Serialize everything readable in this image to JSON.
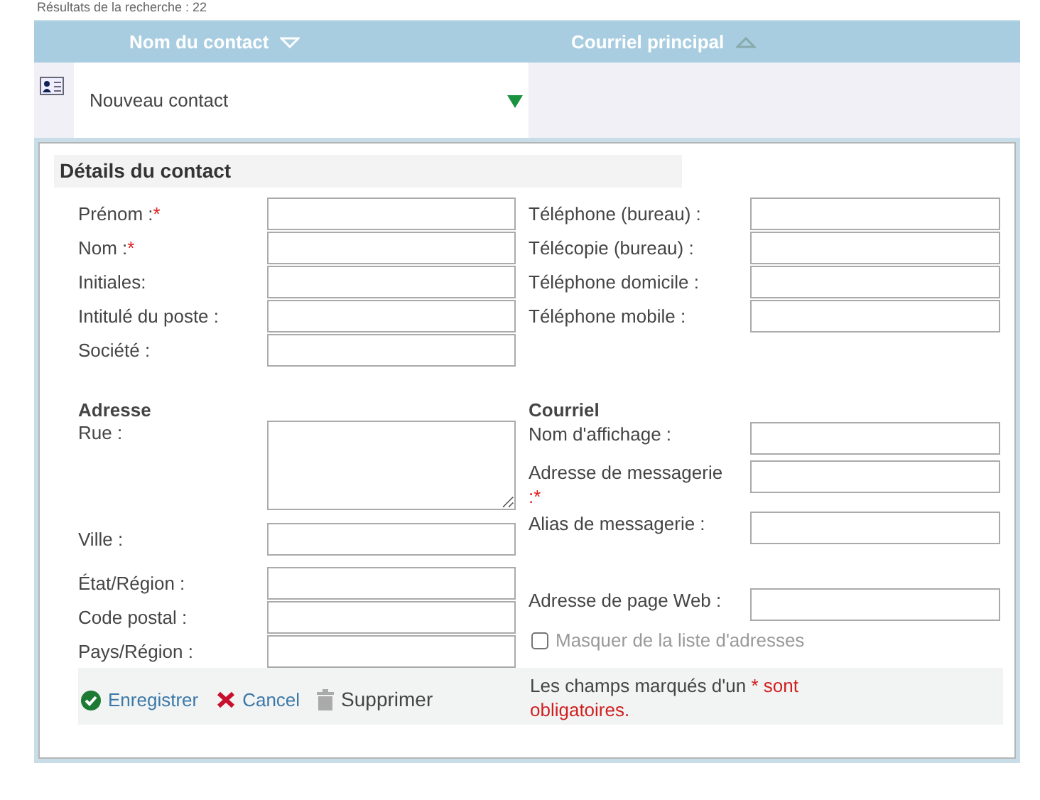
{
  "results_caption": "Résultats de la recherche : 22",
  "table": {
    "columns": [
      {
        "label": "Nom du contact",
        "sort_descending": true
      },
      {
        "label": "Courriel principal",
        "sort_descending": false
      }
    ],
    "rows": [
      {
        "name": "Nouveau contact",
        "expanded": true
      }
    ]
  },
  "details": {
    "title": "Détails du contact",
    "left": [
      {
        "label": "Prénom :",
        "required_mark": "*"
      },
      {
        "label": "Nom :",
        "required_mark": "*"
      },
      {
        "label": "Initiales:"
      },
      {
        "label": "Intitulé du poste :"
      },
      {
        "label": "Société :"
      }
    ],
    "right": [
      {
        "label": "Téléphone (bureau) :"
      },
      {
        "label": "Télécopie (bureau) :"
      },
      {
        "label": "Téléphone domicile :"
      },
      {
        "label": "Téléphone mobile :"
      }
    ]
  },
  "address": {
    "title": "Adresse",
    "fields": [
      {
        "label": "Rue :",
        "kind": "textarea"
      },
      {
        "label": "Ville :",
        "kind": "input"
      },
      {
        "label": "État/Région :",
        "kind": "input"
      },
      {
        "label": "Code postal :",
        "kind": "input"
      },
      {
        "label": "Pays/Région :",
        "kind": "input"
      }
    ]
  },
  "email": {
    "title": "Courriel",
    "fields": [
      {
        "label": "Nom d'affichage :",
        "kind": "input"
      },
      {
        "label": "Adresse de messagerie",
        "required_mark": ":*",
        "kind": "input"
      },
      {
        "label": "Alias de messagerie :",
        "kind": "input"
      },
      {
        "label": "Adresse de page Web :",
        "kind": "input"
      },
      {
        "label": "Masquer de la liste d'adresses",
        "kind": "checkbox",
        "checked": false
      }
    ]
  },
  "actions": [
    {
      "label": "Enregistrer",
      "kind": "save",
      "disabled": false
    },
    {
      "label": "Cancel",
      "kind": "cancel",
      "disabled": false
    },
    {
      "label": "Supprimer",
      "kind": "delete",
      "disabled": true
    }
  ],
  "note": {
    "text": "Les champs marqués d'un",
    "highlight": "* sont obligatoires."
  }
}
